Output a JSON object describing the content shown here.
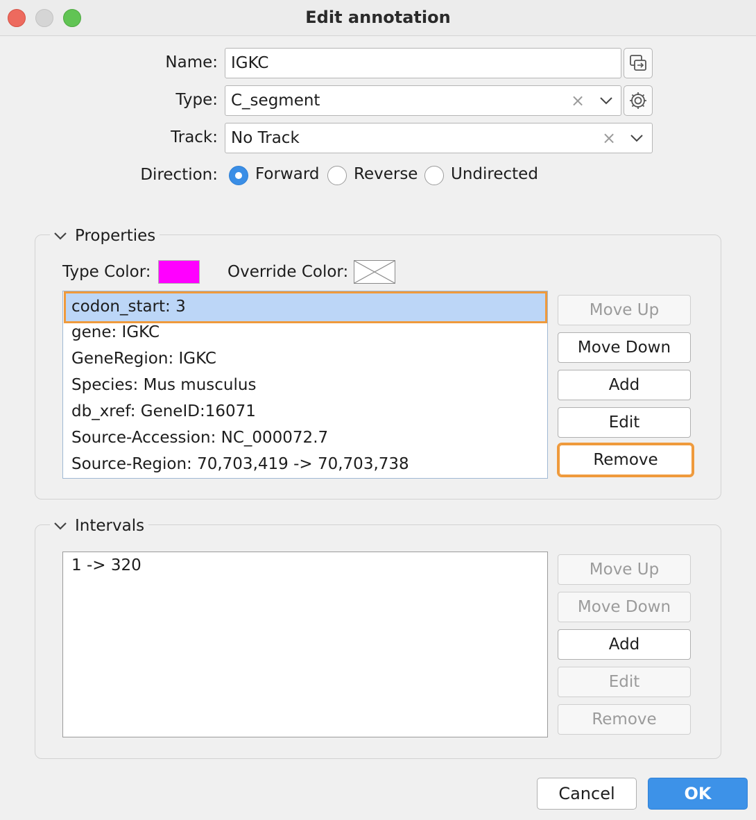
{
  "window": {
    "title": "Edit annotation"
  },
  "form": {
    "name_label": "Name:",
    "name_value": "IGKC",
    "type_label": "Type:",
    "type_value": "C_segment",
    "track_label": "Track:",
    "track_value": "No Track",
    "direction_label": "Direction:",
    "direction_options": [
      "Forward",
      "Reverse",
      "Undirected"
    ],
    "direction_selected": "Forward",
    "clear_glyph": "×"
  },
  "properties": {
    "title": "Properties",
    "type_color_label": "Type Color:",
    "type_color": "#ff00ff",
    "override_color_label": "Override Color:",
    "items": [
      "codon_start: 3",
      "gene: IGKC",
      "GeneRegion: IGKC",
      "Species: Mus musculus",
      "db_xref: GeneID:16071",
      "Source-Accession: NC_000072.7",
      "Source-Region: 70,703,419 -> 70,703,738"
    ],
    "selected_index": 0,
    "buttons": {
      "move_up": "Move Up",
      "move_down": "Move Down",
      "add": "Add",
      "edit": "Edit",
      "remove": "Remove"
    }
  },
  "intervals": {
    "title": "Intervals",
    "items": [
      "1 -> 320"
    ],
    "buttons": {
      "move_up": "Move Up",
      "move_down": "Move Down",
      "add": "Add",
      "edit": "Edit",
      "remove": "Remove"
    }
  },
  "footer": {
    "cancel": "Cancel",
    "ok": "OK"
  },
  "colors": {
    "accent": "#3d92e8",
    "focus": "#ef9a3c",
    "selection": "#bcd6f7"
  }
}
